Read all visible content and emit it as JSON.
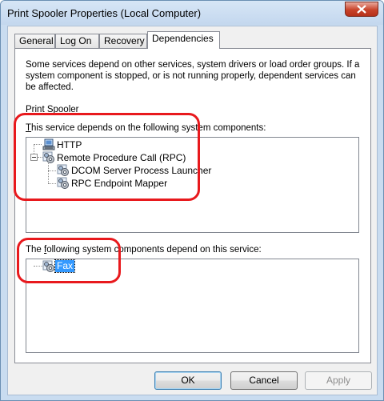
{
  "window": {
    "title": "Print Spooler Properties (Local Computer)"
  },
  "tabs": [
    {
      "label": "General"
    },
    {
      "label": "Log On"
    },
    {
      "label": "Recovery"
    },
    {
      "label": "Dependencies",
      "active": true
    }
  ],
  "dependencies": {
    "description": "Some services depend on other services, system drivers or load order groups. If a system component is stopped, or is not running properly, dependent services can be affected.",
    "service_name": "Print Spooler",
    "depends_on_label_accel": "T",
    "depends_on_label_rest": "his service depends on the following system components:",
    "depends_on_tree": [
      {
        "label": "HTTP",
        "icon": "driver-icon",
        "level": 0
      },
      {
        "label": "Remote Procedure Call (RPC)",
        "icon": "service-gear-icon",
        "level": 0,
        "expanded": true
      },
      {
        "label": "DCOM Server Process Launcher",
        "icon": "service-gear-icon",
        "level": 1
      },
      {
        "label": "RPC Endpoint Mapper",
        "icon": "service-gear-icon",
        "level": 1
      }
    ],
    "dependents_label_pre": "The ",
    "dependents_label_accel": "f",
    "dependents_label_rest": "ollowing system components depend on this service:",
    "dependents_tree": [
      {
        "label": "Fax",
        "icon": "service-gear-icon",
        "level": 0,
        "selected": true
      }
    ]
  },
  "buttons": {
    "ok": "OK",
    "cancel": "Cancel",
    "apply": "Apply"
  },
  "colors": {
    "annotation": "#e8191d",
    "selection": "#3399ff"
  }
}
